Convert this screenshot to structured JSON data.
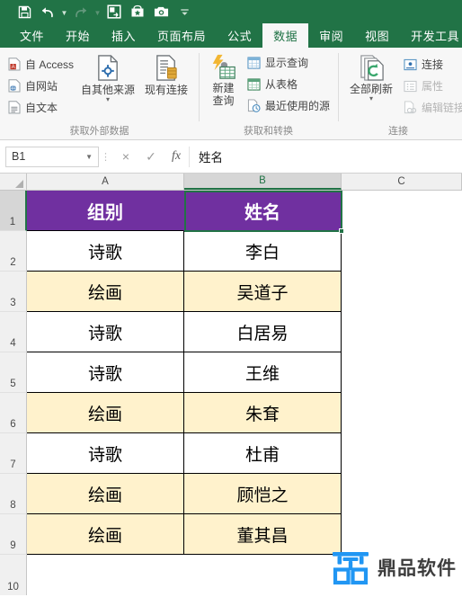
{
  "app": {
    "quick_access": [
      {
        "name": "save-icon",
        "label": "保存"
      },
      {
        "name": "undo-icon",
        "label": "撤销"
      },
      {
        "name": "redo-icon",
        "label": "恢复"
      },
      {
        "name": "quick-print-icon",
        "label": "快速打印"
      },
      {
        "name": "favorites-icon",
        "label": "收藏"
      },
      {
        "name": "camera-icon",
        "label": "照相机"
      },
      {
        "name": "customize-qat-icon",
        "label": "自定义快速访问工具栏"
      }
    ]
  },
  "ribbon": {
    "tabs": [
      {
        "label": "文件",
        "active": false
      },
      {
        "label": "开始",
        "active": false
      },
      {
        "label": "插入",
        "active": false
      },
      {
        "label": "页面布局",
        "active": false
      },
      {
        "label": "公式",
        "active": false
      },
      {
        "label": "数据",
        "active": true
      },
      {
        "label": "审阅",
        "active": false
      },
      {
        "label": "视图",
        "active": false
      },
      {
        "label": "开发工具",
        "active": false
      }
    ],
    "groups": [
      {
        "title": "获取外部数据",
        "small_commands": [
          {
            "label": "自 Access",
            "icon": "access-file-icon",
            "disabled": false
          },
          {
            "label": "自网站",
            "icon": "web-file-icon",
            "disabled": false
          },
          {
            "label": "自文本",
            "icon": "text-file-icon",
            "disabled": false
          }
        ],
        "big_commands": [
          {
            "label_line1": "自其他来源",
            "label_line2": "",
            "icon": "other-sources-icon",
            "has_caret": true
          },
          {
            "label_line1": "现有连接",
            "label_line2": "",
            "icon": "existing-connections-icon",
            "has_caret": false
          }
        ]
      },
      {
        "title": "获取和转换",
        "small_commands": [
          {
            "label": "显示查询",
            "icon": "show-queries-icon",
            "disabled": false
          },
          {
            "label": "从表格",
            "icon": "from-table-icon",
            "disabled": false
          },
          {
            "label": "最近使用的源",
            "icon": "recent-sources-icon",
            "disabled": false
          }
        ],
        "big_commands": [
          {
            "label_line1": "新建",
            "label_line2": "查询",
            "icon": "new-query-icon",
            "has_caret": true
          }
        ]
      },
      {
        "title": "连接",
        "small_commands": [
          {
            "label": "连接",
            "icon": "connections-icon",
            "disabled": false
          },
          {
            "label": "属性",
            "icon": "properties-icon",
            "disabled": true
          },
          {
            "label": "编辑链接",
            "icon": "edit-links-icon",
            "disabled": true
          }
        ],
        "big_commands": [
          {
            "label_line1": "全部刷新",
            "label_line2": "",
            "icon": "refresh-all-icon",
            "has_caret": true
          }
        ]
      }
    ]
  },
  "formula_bar": {
    "name_box_value": "B1",
    "cancel_icon": "×",
    "confirm_icon": "✓",
    "fx_icon": "fx",
    "formula_value": "姓名"
  },
  "grid": {
    "columns": [
      {
        "label": "A",
        "selected": false
      },
      {
        "label": "B",
        "selected": true
      },
      {
        "label": "C",
        "selected": false
      }
    ],
    "rows": [
      {
        "num": "1",
        "selected": true,
        "a": "组别",
        "b": "姓名",
        "style": "header"
      },
      {
        "num": "2",
        "selected": false,
        "a": "诗歌",
        "b": "李白",
        "style": "white"
      },
      {
        "num": "3",
        "selected": false,
        "a": "绘画",
        "b": "吴道子",
        "style": "tan"
      },
      {
        "num": "4",
        "selected": false,
        "a": "诗歌",
        "b": "白居易",
        "style": "white"
      },
      {
        "num": "5",
        "selected": false,
        "a": "诗歌",
        "b": "王维",
        "style": "white"
      },
      {
        "num": "6",
        "selected": false,
        "a": "绘画",
        "b": "朱耷",
        "style": "tan"
      },
      {
        "num": "7",
        "selected": false,
        "a": "诗歌",
        "b": "杜甫",
        "style": "white"
      },
      {
        "num": "8",
        "selected": false,
        "a": "绘画",
        "b": "顾恺之",
        "style": "tan"
      },
      {
        "num": "9",
        "selected": false,
        "a": "绘画",
        "b": "董其昌",
        "style": "tan"
      },
      {
        "num": "10",
        "selected": false,
        "a": "",
        "b": "",
        "style": "empty"
      }
    ]
  },
  "watermark": {
    "text": "鼎品软件",
    "logo_icon": "ding-logo-icon"
  },
  "colors": {
    "ribbon_green": "#217346",
    "header_purple": "#7030a0",
    "alt_row_tan": "#fff2cc",
    "selection_green": "#217346",
    "watermark_blue": "#2196f3"
  }
}
